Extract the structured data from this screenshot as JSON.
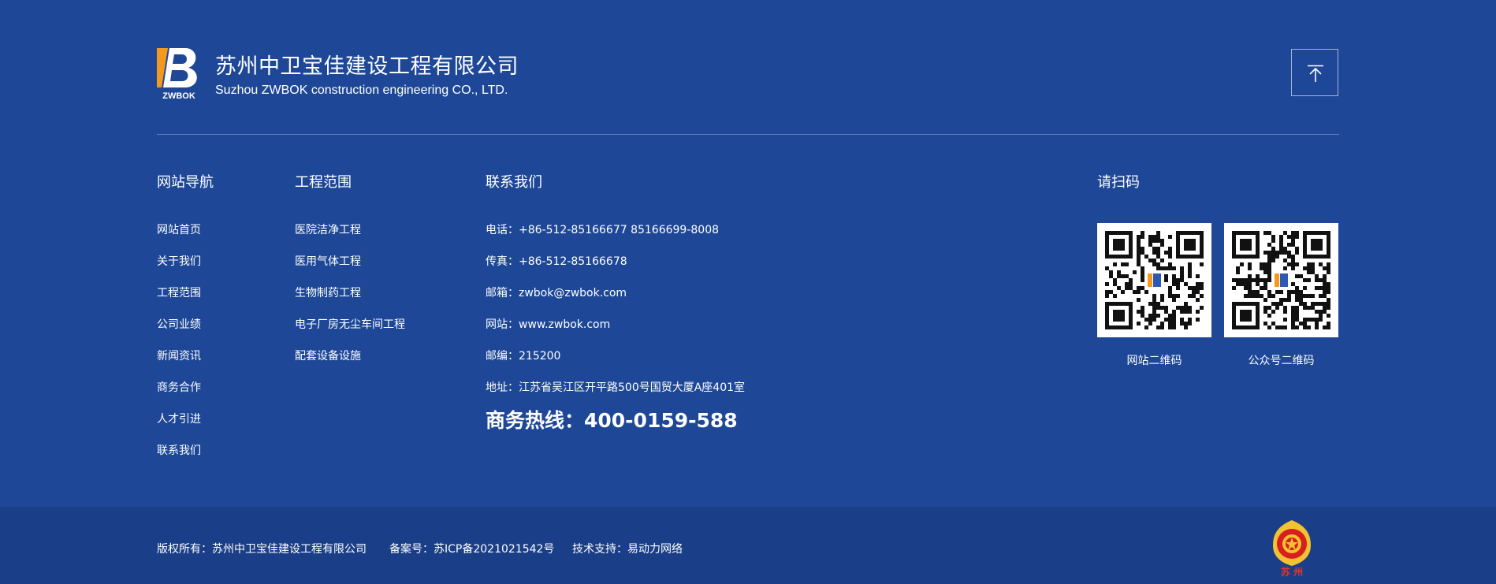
{
  "header": {
    "logo_text": "ZWBOK",
    "company_cn": "苏州中卫宝佳建设工程有限公司",
    "company_en": "Suzhou ZWBOK construction engineering CO., LTD.",
    "back_to_top_icon": "arrow-up-to-line-icon"
  },
  "nav": {
    "title": "网站导航",
    "items": [
      "网站首页",
      "关于我们",
      "工程范围",
      "公司业绩",
      "新闻资讯",
      "商务合作",
      "人才引进",
      "联系我们"
    ]
  },
  "scope": {
    "title": "工程范围",
    "items": [
      "医院洁净工程",
      "医用气体工程",
      "生物制药工程",
      "电子厂房无尘车间工程",
      "配套设备设施"
    ]
  },
  "contact": {
    "title": "联系我们",
    "lines": [
      "电话：+86-512-85166677 85166699-8008",
      "传真：+86-512-85166678",
      "邮箱：zwbok@zwbok.com",
      "网站：www.zwbok.com",
      "邮编：215200",
      "地址：江苏省吴江区开平路500号国贸大厦A座401室"
    ],
    "hotline": "商务热线：400-0159-588"
  },
  "qr": {
    "title": "请扫码",
    "codes": [
      {
        "label": "网站二维码"
      },
      {
        "label": "公众号二维码"
      }
    ]
  },
  "bottom": {
    "copyright": "版权所有：苏州中卫宝佳建设工程有限公司",
    "icp": "备案号：苏ICP备2021021542号",
    "support": "技术支持：易动力网络",
    "emblem_text": "苏 州"
  },
  "colors": {
    "background": "#1e4897",
    "bottom_bar": "#1a3f88",
    "logo_orange": "#f39a1e",
    "emblem_red": "#d81e1e",
    "emblem_gold": "#f2c230"
  }
}
